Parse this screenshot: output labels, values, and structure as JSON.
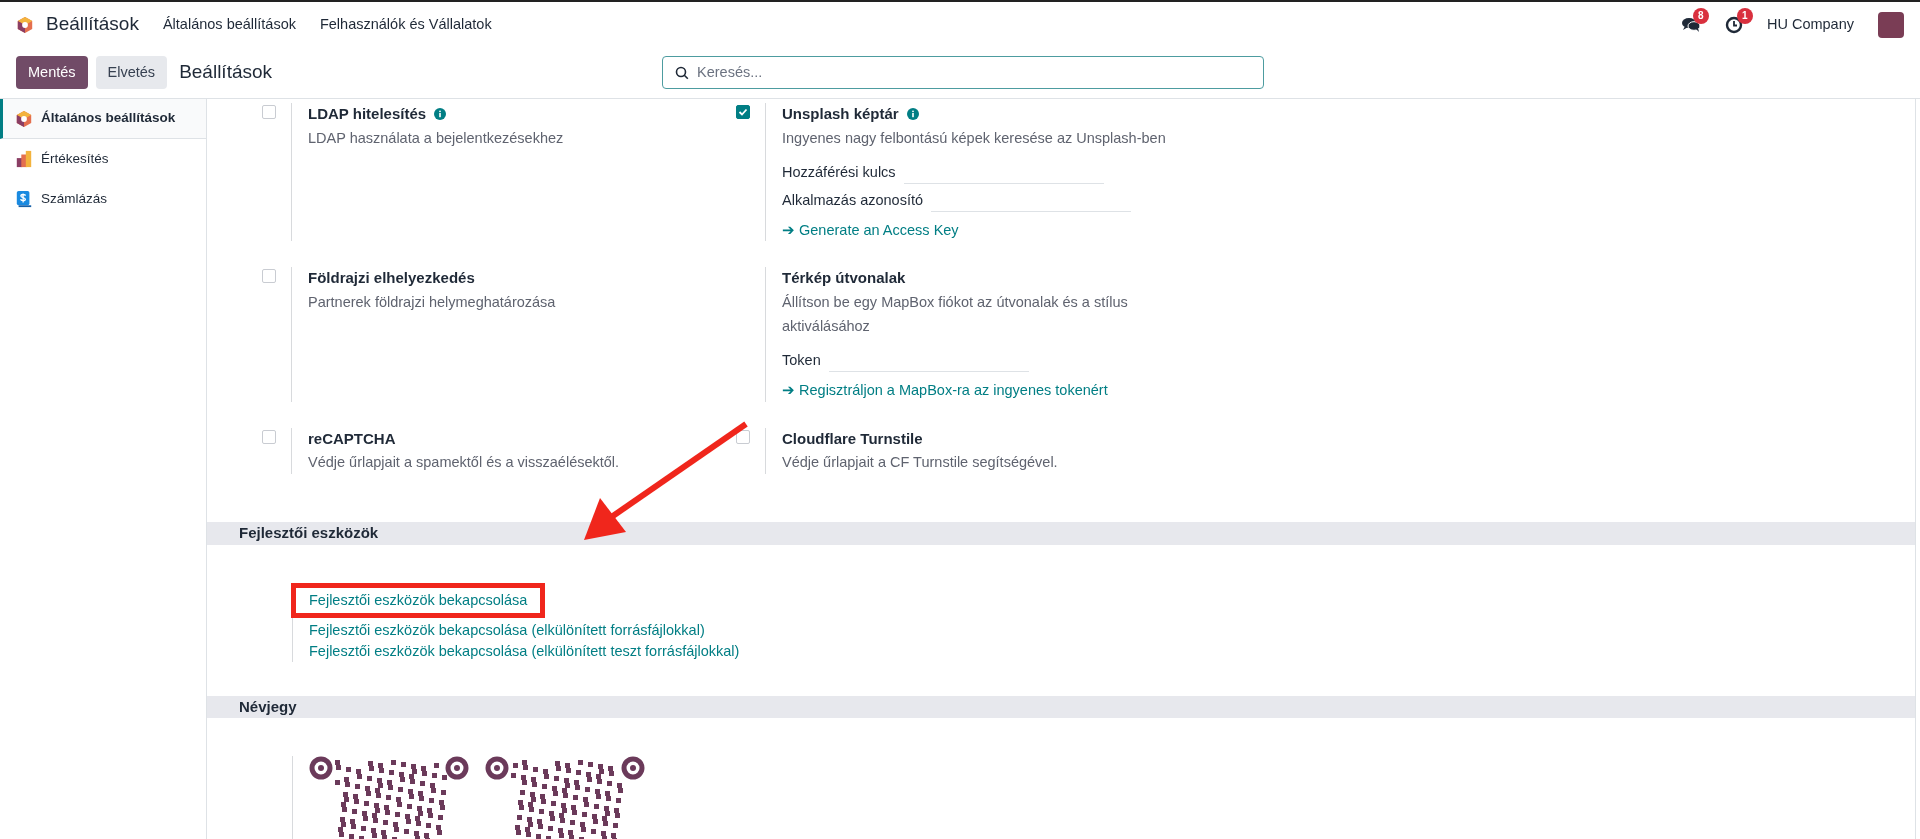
{
  "navbar": {
    "app_title": "Beállítások",
    "menu": [
      {
        "label": "Általános beállítások"
      },
      {
        "label": "Felhasználók és Vállalatok"
      }
    ],
    "messages_count": "8",
    "activities_count": "1",
    "company": "HU Company"
  },
  "control_panel": {
    "save": "Mentés",
    "discard": "Elvetés",
    "breadcrumb": "Beállítások",
    "search": {
      "placeholder": "Keresés..."
    }
  },
  "sidebar": {
    "items": [
      {
        "label": "Általános beállítások",
        "selected": true,
        "kind": "general"
      },
      {
        "label": "Értékesítés",
        "selected": false,
        "kind": "sales"
      },
      {
        "label": "Számlázás",
        "selected": false,
        "kind": "invoicing"
      }
    ]
  },
  "settings_rows": [
    {
      "left": {
        "title": "LDAP hitelesítés",
        "info": true,
        "checked": false,
        "description": "LDAP használata a bejelentkezésekhez"
      },
      "right": {
        "title": "Unsplash képtár",
        "info": true,
        "checked": true,
        "description": "Ingyenes nagy felbontású képek keresése az Unsplash-ben",
        "fields": [
          {
            "label": "Hozzáférési kulcs"
          },
          {
            "label": "Alkalmazás azonosító"
          }
        ],
        "links": [
          "➔ Generate an Access Key"
        ]
      }
    },
    {
      "left": {
        "title": "Földrajzi elhelyezkedés",
        "checked": false,
        "description": "Partnerek földrajzi helymeghatározása"
      },
      "right": {
        "title": "Térkép útvonalak",
        "description": "Állítson be egy MapBox fiókot az útvonalak és a stílus aktiválásához",
        "fields": [
          {
            "label": "Token"
          }
        ],
        "links": [
          "➔ Regisztráljon a MapBox-ra az ingyenes tokenért"
        ]
      }
    },
    {
      "left": {
        "title": "reCAPTCHA",
        "checked": false,
        "description": "Védje űrlapjait a spamektől és a visszaélésektől."
      },
      "right": {
        "title": "Cloudflare Turnstile",
        "checked": false,
        "description": "Védje űrlapjait a CF Turnstile segítségével."
      }
    }
  ],
  "developer_tools": {
    "title": "Fejlesztői eszközök",
    "links": [
      {
        "label": "Fejlesztői eszközök bekapcsolása",
        "highlighted": true
      },
      {
        "label": "Fejlesztői eszközök bekapcsolása (elkülönített forrásfájlokkal)",
        "highlighted": false
      },
      {
        "label": "Fejlesztői eszközök bekapcsolása (elkülönített teszt forrásfájlokkal)",
        "highlighted": false
      }
    ]
  },
  "about": {
    "title": "Névjegy"
  }
}
